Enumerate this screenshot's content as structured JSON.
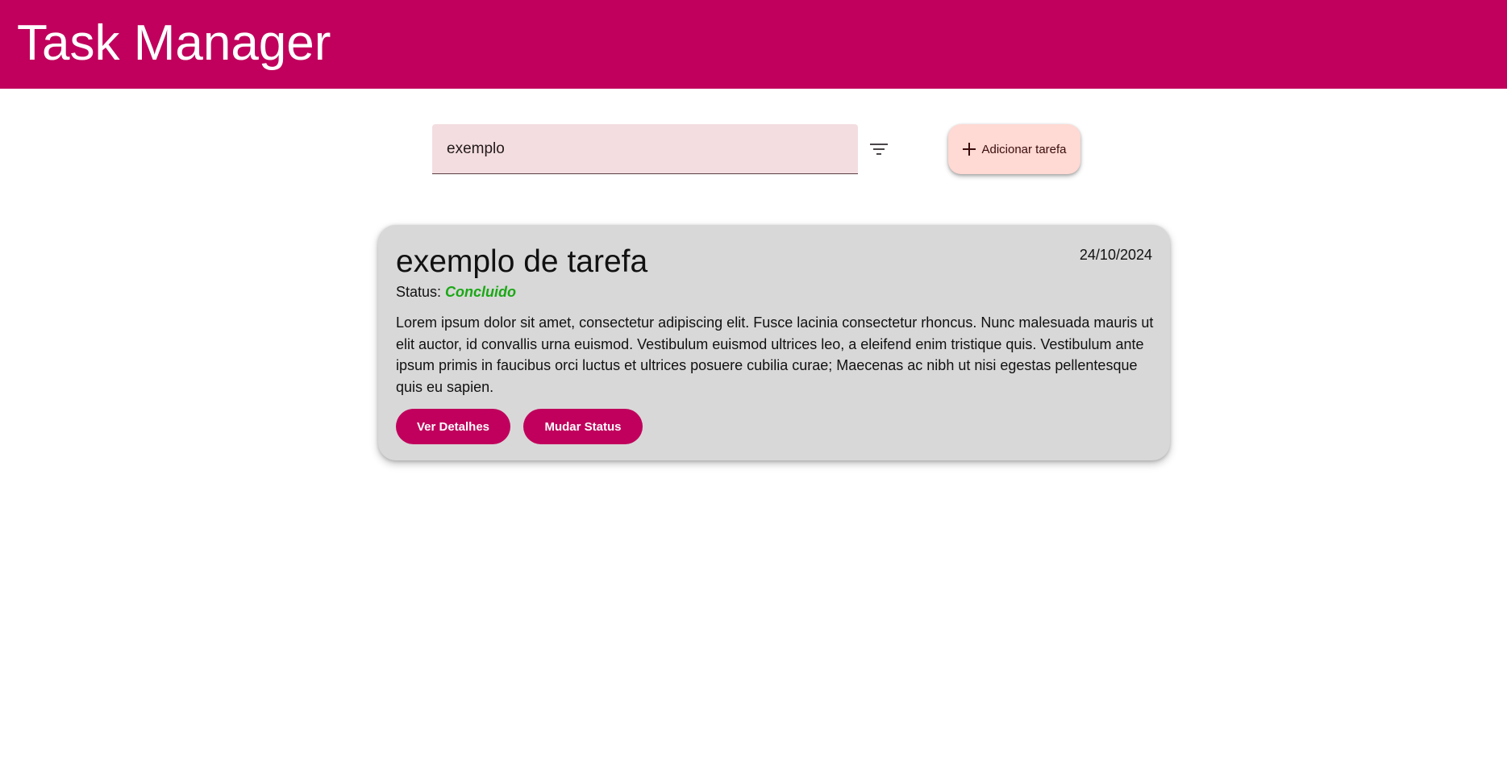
{
  "header": {
    "title": "Task Manager"
  },
  "toolbar": {
    "search": {
      "value": "exemplo",
      "placeholder": ""
    },
    "filter_icon": "filter-list-icon",
    "add_button": {
      "icon": "plus-icon",
      "label": "Adicionar tarefa"
    }
  },
  "tasks": [
    {
      "title": "exemplo de tarefa",
      "date": "24/10/2024",
      "status_label": "Status:",
      "status_value": "Concluido",
      "description": "Lorem ipsum dolor sit amet, consectetur adipiscing elit. Fusce lacinia consectetur rhoncus. Nunc malesuada mauris ut elit auctor, id convallis urna euismod. Vestibulum euismod ultrices leo, a eleifend enim tristique quis. Vestibulum ante ipsum primis in faucibus orci luctus et ultrices posuere cubilia curae; Maecenas ac nibh ut nisi egestas pellentesque quis eu sapien.",
      "details_button": "Ver Detalhes",
      "status_button": "Mudar Status"
    }
  ],
  "colors": {
    "primary": "#c0005c",
    "search_bg": "#f3dde0",
    "add_button_bg": "#ffd9d3",
    "card_bg": "#d8d8d8",
    "status_done": "#1aa815"
  }
}
